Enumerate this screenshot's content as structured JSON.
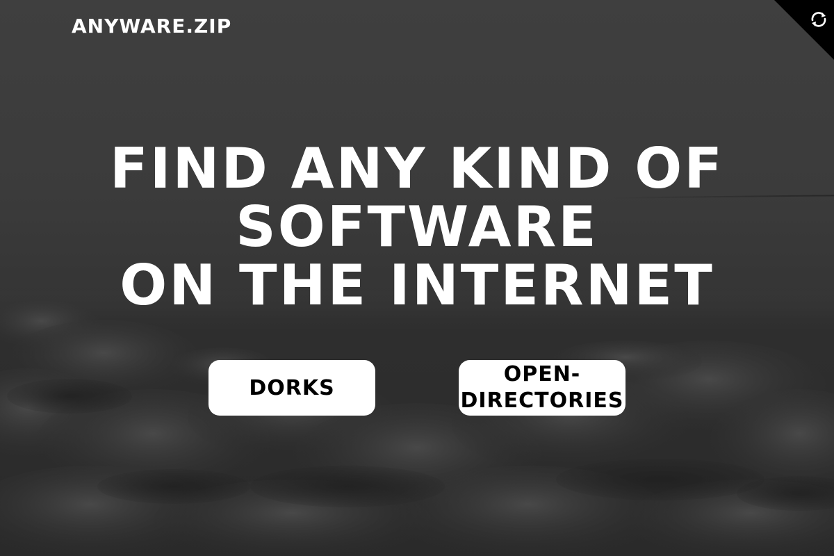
{
  "brand": {
    "name": "ANYWARE.ZIP"
  },
  "hero": {
    "line1": "FIND ANY KIND OF",
    "line2": "SOFTWARE",
    "line3": "ON THE INTERNET"
  },
  "buttons": {
    "dorks_label": "DORKS",
    "open_directories_label_line1": "OPEN-",
    "open_directories_label_line2": "DIRECTORIES"
  },
  "corner": {
    "icon": "github-octocat-icon"
  },
  "colors": {
    "background": "#3a3a3a",
    "text": "#ffffff",
    "button_bg": "#ffffff",
    "button_text": "#000000",
    "corner_bg": "#000000"
  }
}
